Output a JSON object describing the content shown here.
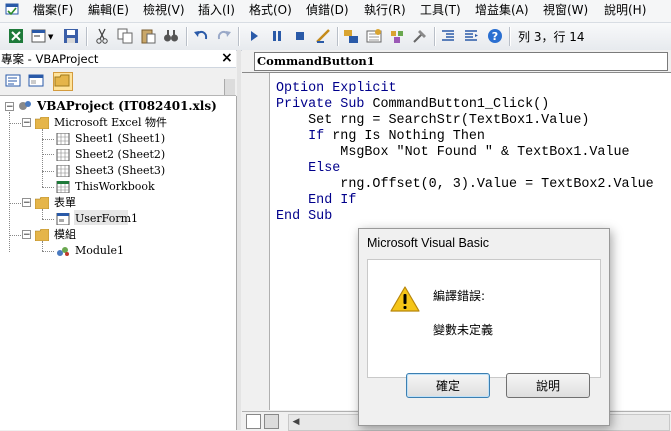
{
  "menu": {
    "items": [
      "檔案(F)",
      "編輯(E)",
      "檢視(V)",
      "插入(I)",
      "格式(O)",
      "偵錯(D)",
      "執行(R)",
      "工具(T)",
      "增益集(A)",
      "視窗(W)",
      "說明(H)"
    ]
  },
  "toolbar": {
    "cursor_position": "列 3，行 14"
  },
  "project_explorer": {
    "title": "專案 - VBAProject",
    "tree": {
      "project": "VBAProject (IT082401.xls)",
      "excel_objects_folder": "Microsoft Excel 物件",
      "sheet1": "Sheet1 (Sheet1)",
      "sheet2": "Sheet2 (Sheet2)",
      "sheet3": "Sheet3 (Sheet3)",
      "workbook": "ThisWorkbook",
      "forms_folder": "表單",
      "userform": "UserForm1",
      "modules_folder": "模組",
      "module": "Module1"
    }
  },
  "code_window": {
    "object_combo": "CommandButton1",
    "lines": [
      {
        "kw": "Option Explicit",
        "rest": ""
      },
      {
        "kw": "Private Sub",
        "rest": " CommandButton1_Click()"
      },
      {
        "kw": "",
        "rest": "    Set rng = SearchStr(TextBox1.Value)"
      },
      {
        "kw": "    If",
        "rest": " rng Is Nothing Then"
      },
      {
        "kw": "",
        "rest": "        MsgBox \"Not Found \" & TextBox1.Value"
      },
      {
        "kw": "    Else",
        "rest": ""
      },
      {
        "kw": "",
        "rest": "        rng.Offset(0, 3).Value = TextBox2.Value"
      },
      {
        "kw": "    End If",
        "rest": ""
      },
      {
        "kw": "End Sub",
        "rest": ""
      }
    ]
  },
  "dialog": {
    "title": "Microsoft Visual Basic",
    "message_line1": "編譯錯誤:",
    "message_line2": "變數未定義",
    "ok_label": "確定",
    "help_label": "說明"
  },
  "icons": [
    "app-icon",
    "excel-icon",
    "insert-userform-icon",
    "save-icon",
    "cut-icon",
    "copy-icon",
    "paste-icon",
    "find-icon",
    "undo-icon",
    "redo-icon",
    "run-icon",
    "break-icon",
    "reset-icon",
    "design-mode-icon",
    "project-explorer-icon",
    "properties-icon",
    "object-browser-icon",
    "toolbox-icon",
    "help-icon",
    "warning-icon"
  ],
  "colors": {
    "keyword": "#00008b",
    "selected_toggle": "#ffe39a"
  }
}
